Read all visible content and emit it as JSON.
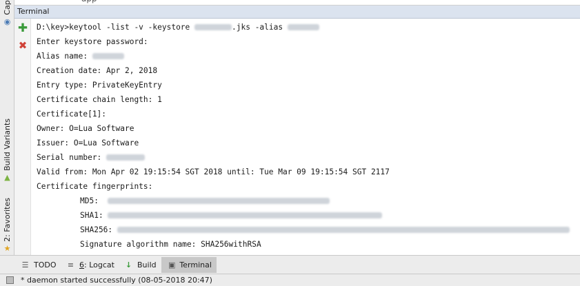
{
  "colors": {
    "panel_header_bg": "#dbe3ef",
    "add_icon": "#3a9a3a",
    "close_icon": "#d04238",
    "active_tab_bg": "#c8c8c8"
  },
  "top_strip": {
    "fragment_left": "app",
    "fragment_right": ""
  },
  "left_strip": {
    "top_tab": "Capt",
    "build_variants": "Build Variants",
    "favorites": "2: Favorites"
  },
  "panel": {
    "title": "Terminal"
  },
  "toolbar": {
    "add_icon": "plus-icon",
    "close_icon": "close-icon"
  },
  "terminal": {
    "line1_prefix": "D:\\key>keytool -list -v -keystore ",
    "line1_mid": ".jks -alias ",
    "line2": "Enter keystore password:",
    "line3": "Alias name: ",
    "line4": "Creation date: Apr 2, 2018",
    "line5": "Entry type: PrivateKeyEntry",
    "line6": "Certificate chain length: 1",
    "line7": "Certificate[1]:",
    "line8": "Owner: O=Lua Software",
    "line9": "Issuer: O=Lua Software",
    "line10": "Serial number: ",
    "line11": "Valid from: Mon Apr 02 19:15:54 SGT 2018 until: Tue Mar 09 19:15:54 SGT 2117",
    "line12": "Certificate fingerprints:",
    "md5_label": "MD5:  ",
    "sha1_label": "SHA1: ",
    "sha256_label": "SHA256: ",
    "sig_alg": "Signature algorithm name: SHA256withRSA"
  },
  "bottom_tabs": {
    "todo": "TODO",
    "logcat_num": "6",
    "logcat": ": Logcat",
    "build": "Build",
    "terminal": "Terminal"
  },
  "status": {
    "message": "* daemon started successfully (08-05-2018 20:47)"
  }
}
